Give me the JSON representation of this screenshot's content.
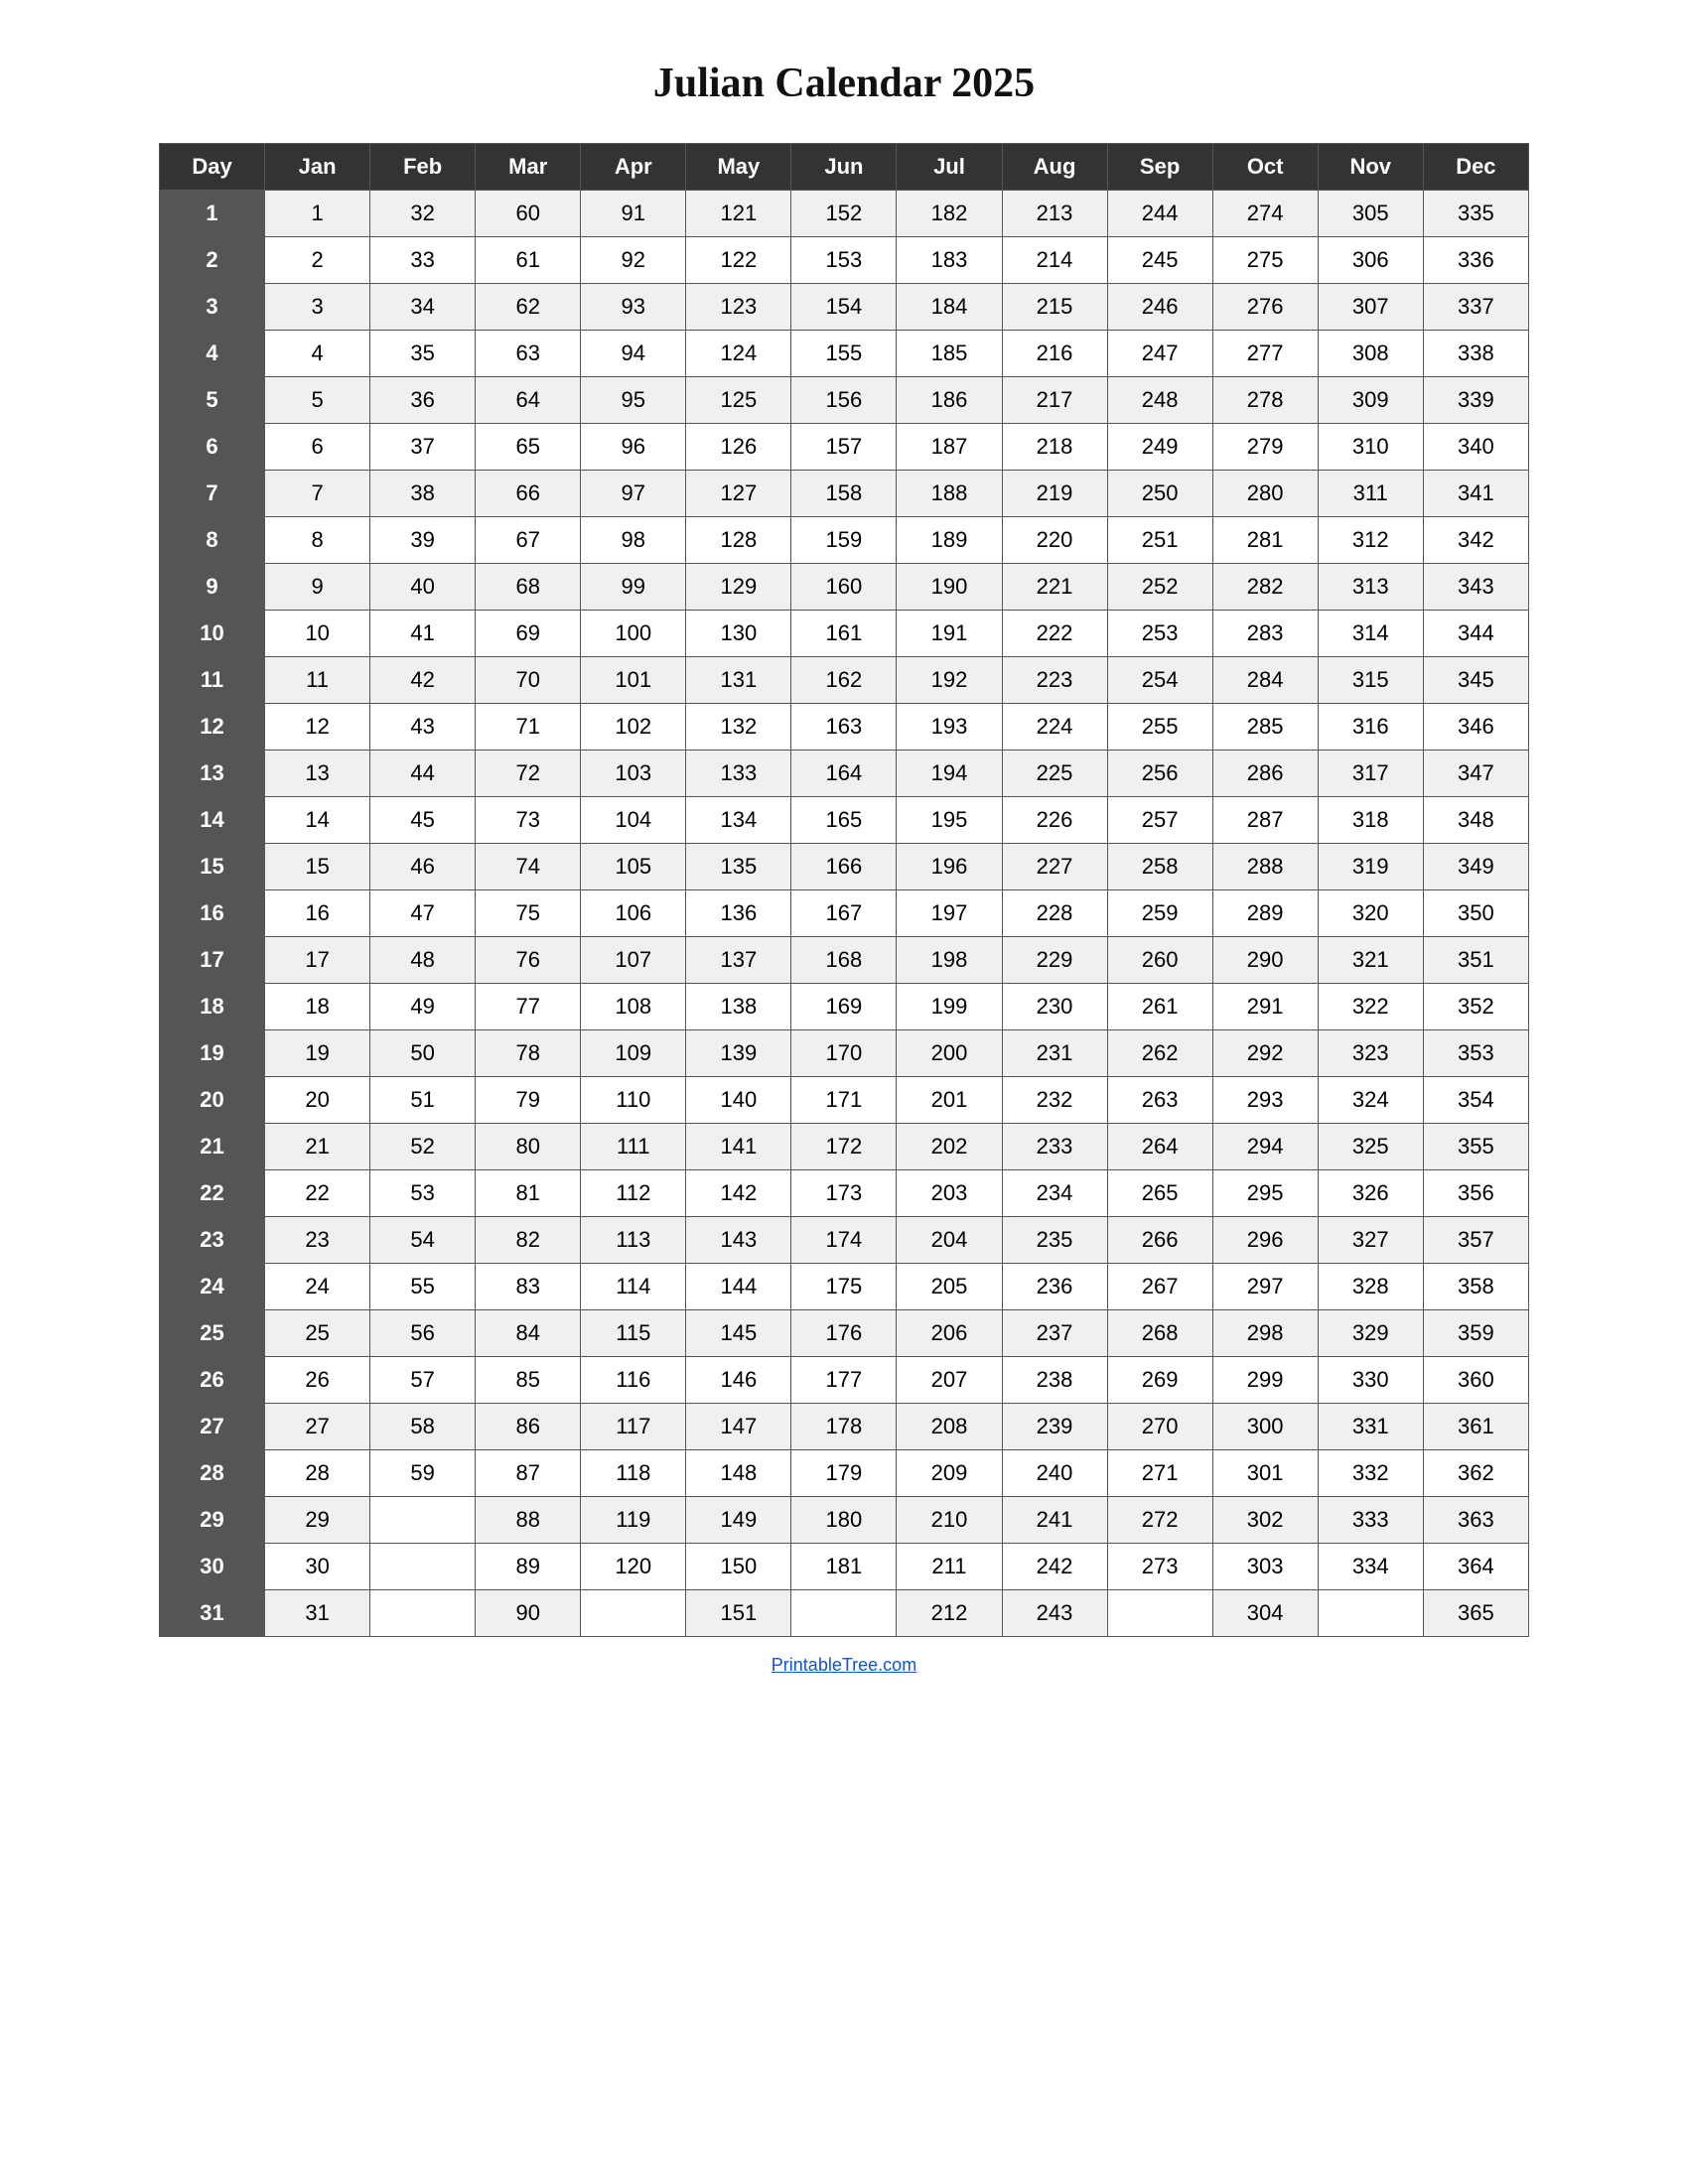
{
  "title": "Julian Calendar 2025",
  "columns": [
    "Day",
    "Jan",
    "Feb",
    "Mar",
    "Apr",
    "May",
    "Jun",
    "Jul",
    "Aug",
    "Sep",
    "Oct",
    "Nov",
    "Dec"
  ],
  "rows": [
    {
      "day": 1,
      "jan": 1,
      "feb": 32,
      "mar": 60,
      "apr": 91,
      "may": 121,
      "jun": 152,
      "jul": 182,
      "aug": 213,
      "sep": 244,
      "oct": 274,
      "nov": 305,
      "dec": 335
    },
    {
      "day": 2,
      "jan": 2,
      "feb": 33,
      "mar": 61,
      "apr": 92,
      "may": 122,
      "jun": 153,
      "jul": 183,
      "aug": 214,
      "sep": 245,
      "oct": 275,
      "nov": 306,
      "dec": 336
    },
    {
      "day": 3,
      "jan": 3,
      "feb": 34,
      "mar": 62,
      "apr": 93,
      "may": 123,
      "jun": 154,
      "jul": 184,
      "aug": 215,
      "sep": 246,
      "oct": 276,
      "nov": 307,
      "dec": 337
    },
    {
      "day": 4,
      "jan": 4,
      "feb": 35,
      "mar": 63,
      "apr": 94,
      "may": 124,
      "jun": 155,
      "jul": 185,
      "aug": 216,
      "sep": 247,
      "oct": 277,
      "nov": 308,
      "dec": 338
    },
    {
      "day": 5,
      "jan": 5,
      "feb": 36,
      "mar": 64,
      "apr": 95,
      "may": 125,
      "jun": 156,
      "jul": 186,
      "aug": 217,
      "sep": 248,
      "oct": 278,
      "nov": 309,
      "dec": 339
    },
    {
      "day": 6,
      "jan": 6,
      "feb": 37,
      "mar": 65,
      "apr": 96,
      "may": 126,
      "jun": 157,
      "jul": 187,
      "aug": 218,
      "sep": 249,
      "oct": 279,
      "nov": 310,
      "dec": 340
    },
    {
      "day": 7,
      "jan": 7,
      "feb": 38,
      "mar": 66,
      "apr": 97,
      "may": 127,
      "jun": 158,
      "jul": 188,
      "aug": 219,
      "sep": 250,
      "oct": 280,
      "nov": 311,
      "dec": 341
    },
    {
      "day": 8,
      "jan": 8,
      "feb": 39,
      "mar": 67,
      "apr": 98,
      "may": 128,
      "jun": 159,
      "jul": 189,
      "aug": 220,
      "sep": 251,
      "oct": 281,
      "nov": 312,
      "dec": 342
    },
    {
      "day": 9,
      "jan": 9,
      "feb": 40,
      "mar": 68,
      "apr": 99,
      "may": 129,
      "jun": 160,
      "jul": 190,
      "aug": 221,
      "sep": 252,
      "oct": 282,
      "nov": 313,
      "dec": 343
    },
    {
      "day": 10,
      "jan": 10,
      "feb": 41,
      "mar": 69,
      "apr": 100,
      "may": 130,
      "jun": 161,
      "jul": 191,
      "aug": 222,
      "sep": 253,
      "oct": 283,
      "nov": 314,
      "dec": 344
    },
    {
      "day": 11,
      "jan": 11,
      "feb": 42,
      "mar": 70,
      "apr": 101,
      "may": 131,
      "jun": 162,
      "jul": 192,
      "aug": 223,
      "sep": 254,
      "oct": 284,
      "nov": 315,
      "dec": 345
    },
    {
      "day": 12,
      "jan": 12,
      "feb": 43,
      "mar": 71,
      "apr": 102,
      "may": 132,
      "jun": 163,
      "jul": 193,
      "aug": 224,
      "sep": 255,
      "oct": 285,
      "nov": 316,
      "dec": 346
    },
    {
      "day": 13,
      "jan": 13,
      "feb": 44,
      "mar": 72,
      "apr": 103,
      "may": 133,
      "jun": 164,
      "jul": 194,
      "aug": 225,
      "sep": 256,
      "oct": 286,
      "nov": 317,
      "dec": 347
    },
    {
      "day": 14,
      "jan": 14,
      "feb": 45,
      "mar": 73,
      "apr": 104,
      "may": 134,
      "jun": 165,
      "jul": 195,
      "aug": 226,
      "sep": 257,
      "oct": 287,
      "nov": 318,
      "dec": 348
    },
    {
      "day": 15,
      "jan": 15,
      "feb": 46,
      "mar": 74,
      "apr": 105,
      "may": 135,
      "jun": 166,
      "jul": 196,
      "aug": 227,
      "sep": 258,
      "oct": 288,
      "nov": 319,
      "dec": 349
    },
    {
      "day": 16,
      "jan": 16,
      "feb": 47,
      "mar": 75,
      "apr": 106,
      "may": 136,
      "jun": 167,
      "jul": 197,
      "aug": 228,
      "sep": 259,
      "oct": 289,
      "nov": 320,
      "dec": 350
    },
    {
      "day": 17,
      "jan": 17,
      "feb": 48,
      "mar": 76,
      "apr": 107,
      "may": 137,
      "jun": 168,
      "jul": 198,
      "aug": 229,
      "sep": 260,
      "oct": 290,
      "nov": 321,
      "dec": 351
    },
    {
      "day": 18,
      "jan": 18,
      "feb": 49,
      "mar": 77,
      "apr": 108,
      "may": 138,
      "jun": 169,
      "jul": 199,
      "aug": 230,
      "sep": 261,
      "oct": 291,
      "nov": 322,
      "dec": 352
    },
    {
      "day": 19,
      "jan": 19,
      "feb": 50,
      "mar": 78,
      "apr": 109,
      "may": 139,
      "jun": 170,
      "jul": 200,
      "aug": 231,
      "sep": 262,
      "oct": 292,
      "nov": 323,
      "dec": 353
    },
    {
      "day": 20,
      "jan": 20,
      "feb": 51,
      "mar": 79,
      "apr": 110,
      "may": 140,
      "jun": 171,
      "jul": 201,
      "aug": 232,
      "sep": 263,
      "oct": 293,
      "nov": 324,
      "dec": 354
    },
    {
      "day": 21,
      "jan": 21,
      "feb": 52,
      "mar": 80,
      "apr": 111,
      "may": 141,
      "jun": 172,
      "jul": 202,
      "aug": 233,
      "sep": 264,
      "oct": 294,
      "nov": 325,
      "dec": 355
    },
    {
      "day": 22,
      "jan": 22,
      "feb": 53,
      "mar": 81,
      "apr": 112,
      "may": 142,
      "jun": 173,
      "jul": 203,
      "aug": 234,
      "sep": 265,
      "oct": 295,
      "nov": 326,
      "dec": 356
    },
    {
      "day": 23,
      "jan": 23,
      "feb": 54,
      "mar": 82,
      "apr": 113,
      "may": 143,
      "jun": 174,
      "jul": 204,
      "aug": 235,
      "sep": 266,
      "oct": 296,
      "nov": 327,
      "dec": 357
    },
    {
      "day": 24,
      "jan": 24,
      "feb": 55,
      "mar": 83,
      "apr": 114,
      "may": 144,
      "jun": 175,
      "jul": 205,
      "aug": 236,
      "sep": 267,
      "oct": 297,
      "nov": 328,
      "dec": 358
    },
    {
      "day": 25,
      "jan": 25,
      "feb": 56,
      "mar": 84,
      "apr": 115,
      "may": 145,
      "jun": 176,
      "jul": 206,
      "aug": 237,
      "sep": 268,
      "oct": 298,
      "nov": 329,
      "dec": 359
    },
    {
      "day": 26,
      "jan": 26,
      "feb": 57,
      "mar": 85,
      "apr": 116,
      "may": 146,
      "jun": 177,
      "jul": 207,
      "aug": 238,
      "sep": 269,
      "oct": 299,
      "nov": 330,
      "dec": 360
    },
    {
      "day": 27,
      "jan": 27,
      "feb": 58,
      "mar": 86,
      "apr": 117,
      "may": 147,
      "jun": 178,
      "jul": 208,
      "aug": 239,
      "sep": 270,
      "oct": 300,
      "nov": 331,
      "dec": 361
    },
    {
      "day": 28,
      "jan": 28,
      "feb": 59,
      "mar": 87,
      "apr": 118,
      "may": 148,
      "jun": 179,
      "jul": 209,
      "aug": 240,
      "sep": 271,
      "oct": 301,
      "nov": 332,
      "dec": 362
    },
    {
      "day": 29,
      "jan": 29,
      "feb": null,
      "mar": 88,
      "apr": 119,
      "may": 149,
      "jun": 180,
      "jul": 210,
      "aug": 241,
      "sep": 272,
      "oct": 302,
      "nov": 333,
      "dec": 363
    },
    {
      "day": 30,
      "jan": 30,
      "feb": null,
      "mar": 89,
      "apr": 120,
      "may": 150,
      "jun": 181,
      "jul": 211,
      "aug": 242,
      "sep": 273,
      "oct": 303,
      "nov": 334,
      "dec": 364
    },
    {
      "day": 31,
      "jan": 31,
      "feb": null,
      "mar": 90,
      "apr": null,
      "may": 151,
      "jun": null,
      "jul": 212,
      "aug": 243,
      "sep": null,
      "oct": 304,
      "nov": null,
      "dec": 365
    }
  ],
  "footer": "PrintableTree.com"
}
